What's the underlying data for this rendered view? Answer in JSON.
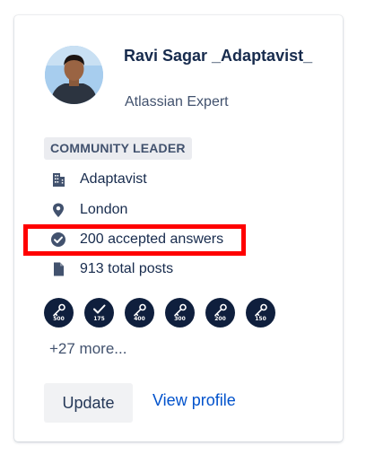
{
  "profile": {
    "name": "Ravi Sagar _Adaptavist_",
    "role": "Atlassian Expert",
    "badge": "COMMUNITY LEADER"
  },
  "info": {
    "company": "Adaptavist",
    "location": "London",
    "accepted": "200 accepted answers",
    "posts": "913 total posts"
  },
  "badges": [
    {
      "icon": "key-icon",
      "label": "500"
    },
    {
      "icon": "check-icon",
      "label": "175"
    },
    {
      "icon": "key-icon",
      "label": "400"
    },
    {
      "icon": "key-icon",
      "label": "300"
    },
    {
      "icon": "key-icon",
      "label": "200"
    },
    {
      "icon": "key-icon",
      "label": "150"
    }
  ],
  "more": "+27 more...",
  "actions": {
    "update": "Update",
    "view_profile": "View profile"
  },
  "colors": {
    "highlight": "#ff0000",
    "link": "#0052cc",
    "badge_bg": "#0f1f3d"
  }
}
